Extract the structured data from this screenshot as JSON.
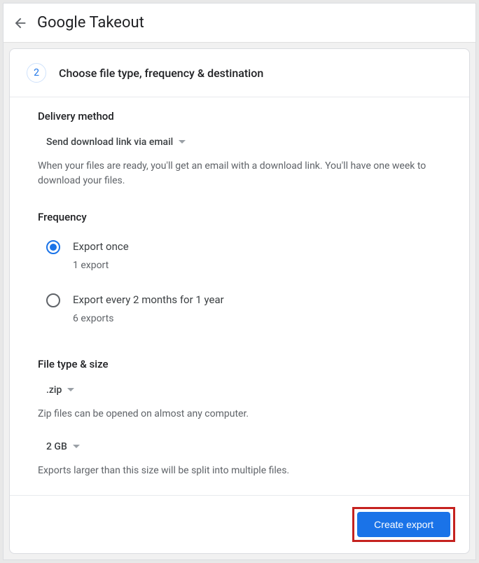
{
  "header": {
    "title": "Google Takeout"
  },
  "step": {
    "number": "2",
    "title": "Choose file type, frequency & destination"
  },
  "delivery": {
    "section_title": "Delivery method",
    "selected": "Send download link via email",
    "helper": "When your files are ready, you'll get an email with a download link. You'll have one week to download your files."
  },
  "frequency": {
    "section_title": "Frequency",
    "options": [
      {
        "label": "Export once",
        "sub": "1 export",
        "selected": true
      },
      {
        "label": "Export every 2 months for 1 year",
        "sub": "6 exports",
        "selected": false
      }
    ]
  },
  "filetype": {
    "section_title": "File type & size",
    "type_value": ".zip",
    "type_helper": "Zip files can be opened on almost any computer.",
    "size_value": "2 GB",
    "size_helper": "Exports larger than this size will be split into multiple files."
  },
  "footer": {
    "create_label": "Create export"
  }
}
